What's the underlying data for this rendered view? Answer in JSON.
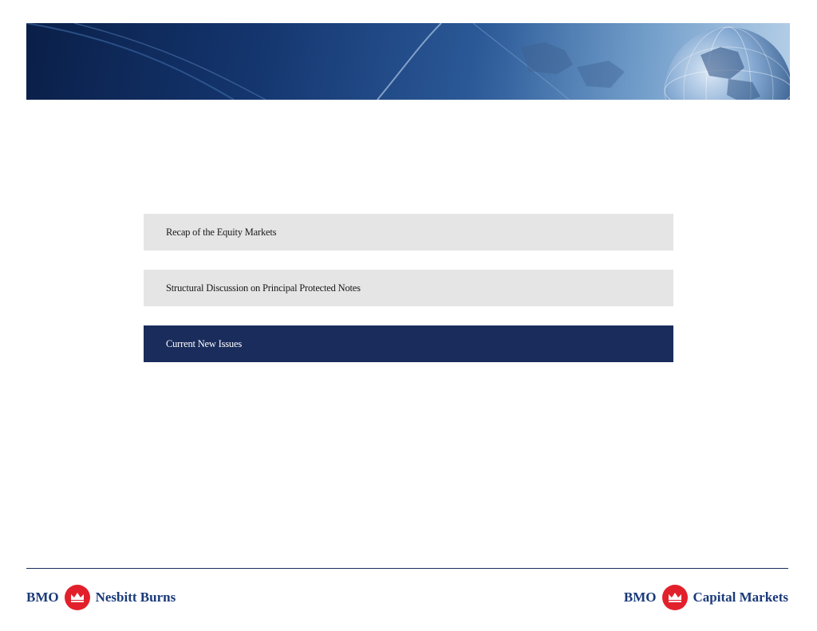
{
  "agenda": {
    "items": [
      {
        "label": "Recap of the Equity Markets",
        "active": false
      },
      {
        "label": "Structural Discussion on Principal Protected Notes",
        "active": false
      },
      {
        "label": "Current New Issues",
        "active": true
      }
    ]
  },
  "footer": {
    "left_logo": {
      "brand": "BMO",
      "division": "Nesbitt Burns"
    },
    "right_logo": {
      "brand": "BMO",
      "division": "Capital Markets"
    }
  },
  "colors": {
    "active_item": "#1a2c5b",
    "inactive_item": "#e5e5e5",
    "brand_red": "#e2202b",
    "brand_blue": "#1a3a7a"
  },
  "icons": {
    "banner": "globe-world-map-banner",
    "logo": "bmo-roundel-icon"
  }
}
